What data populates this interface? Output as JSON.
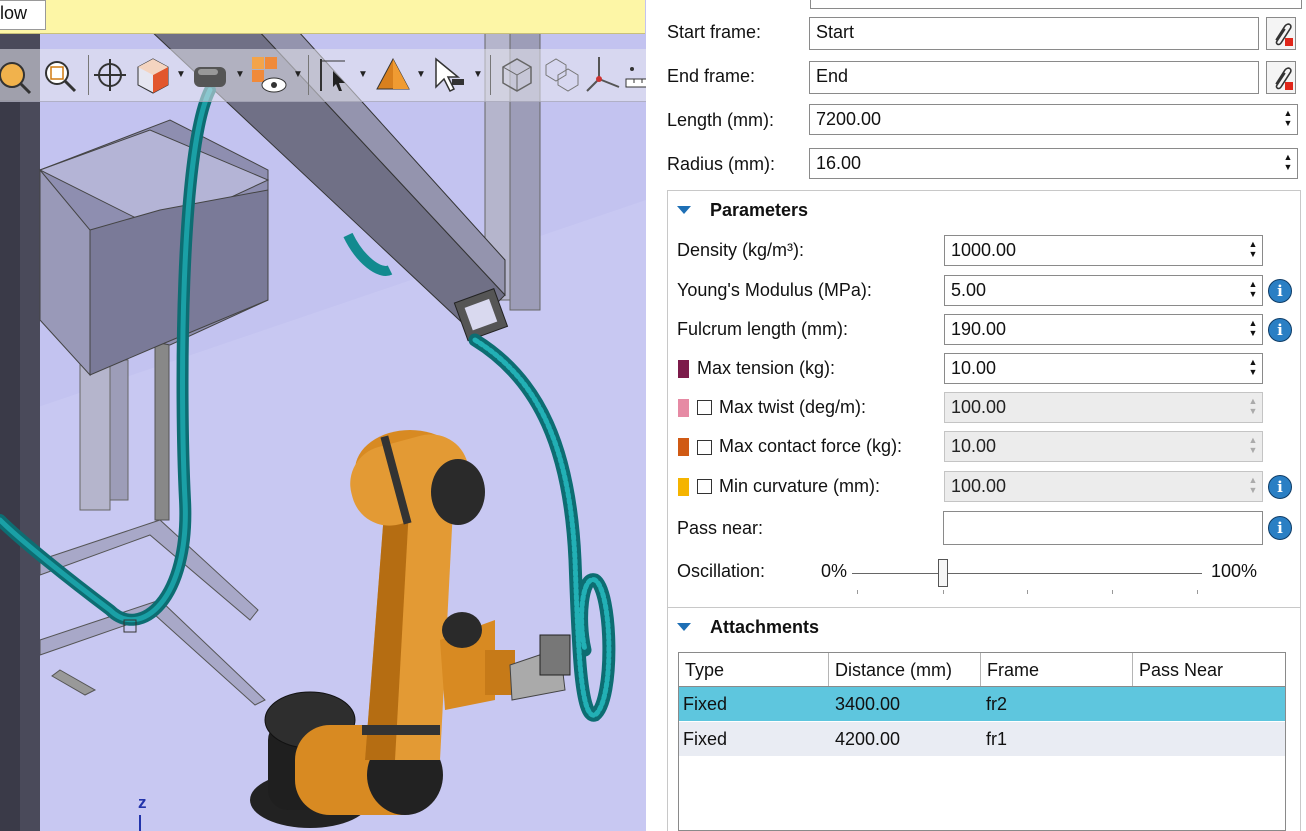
{
  "viewport": {
    "notify_tab": "low",
    "axis_label": "z"
  },
  "toolbar_icons": [
    "select-pointer-icon",
    "zoom-icon",
    "zoom-region-icon",
    "center-target-icon",
    "view-cube-icon",
    "shading-icon",
    "render-display-icon",
    "visibility-eye-icon",
    "frame-select-icon",
    "pyramid-icon",
    "arrow-select-icon",
    "box-view-icon",
    "multi-box-icon",
    "axes-icon",
    "ruler-icon"
  ],
  "frames": {
    "start_label": "Start frame:",
    "start_value": "Start",
    "end_label": "End frame:",
    "end_value": "End",
    "length_label": "Length (mm):",
    "length_value": "7200.00",
    "radius_label": "Radius (mm):",
    "radius_value": "16.00"
  },
  "parameters": {
    "title": "Parameters",
    "density_label": "Density (kg/m³):",
    "density_value": "1000.00",
    "young_label": "Young's Modulus (MPa):",
    "young_value": "5.00",
    "fulcrum_label": "Fulcrum length (mm):",
    "fulcrum_value": "190.00",
    "max_tension_label": "Max tension (kg):",
    "max_tension_value": "10.00",
    "max_tension_color": "#7c1b4a",
    "max_twist_label": "Max twist (deg/m):",
    "max_twist_value": "100.00",
    "max_twist_color": "#e68aa4",
    "max_contact_label": "Max contact force (kg):",
    "max_contact_value": "10.00",
    "max_contact_color": "#d05a14",
    "min_curvature_label": "Min curvature (mm):",
    "min_curvature_value": "100.00",
    "min_curvature_color": "#f5b400",
    "pass_near_label": "Pass near:",
    "pass_near_value": "",
    "oscillation_label": "Oscillation:",
    "oscillation_min": "0%",
    "oscillation_max": "100%",
    "oscillation_level": 0.26
  },
  "attachments": {
    "title": "Attachments",
    "columns": [
      "Type",
      "Distance (mm)",
      "Frame",
      "Pass Near"
    ],
    "rows": [
      {
        "type": "Fixed",
        "distance": "3400.00",
        "frame": "fr2",
        "pass_near": ""
      },
      {
        "type": "Fixed",
        "distance": "4200.00",
        "frame": "fr1",
        "pass_near": ""
      }
    ],
    "selected_color": "#5ec6de",
    "alt_row_color": "#e9ecf3"
  },
  "colors": {
    "cable": "#128a8f",
    "robot": "#d88a22",
    "info": "#2a7fc4"
  }
}
